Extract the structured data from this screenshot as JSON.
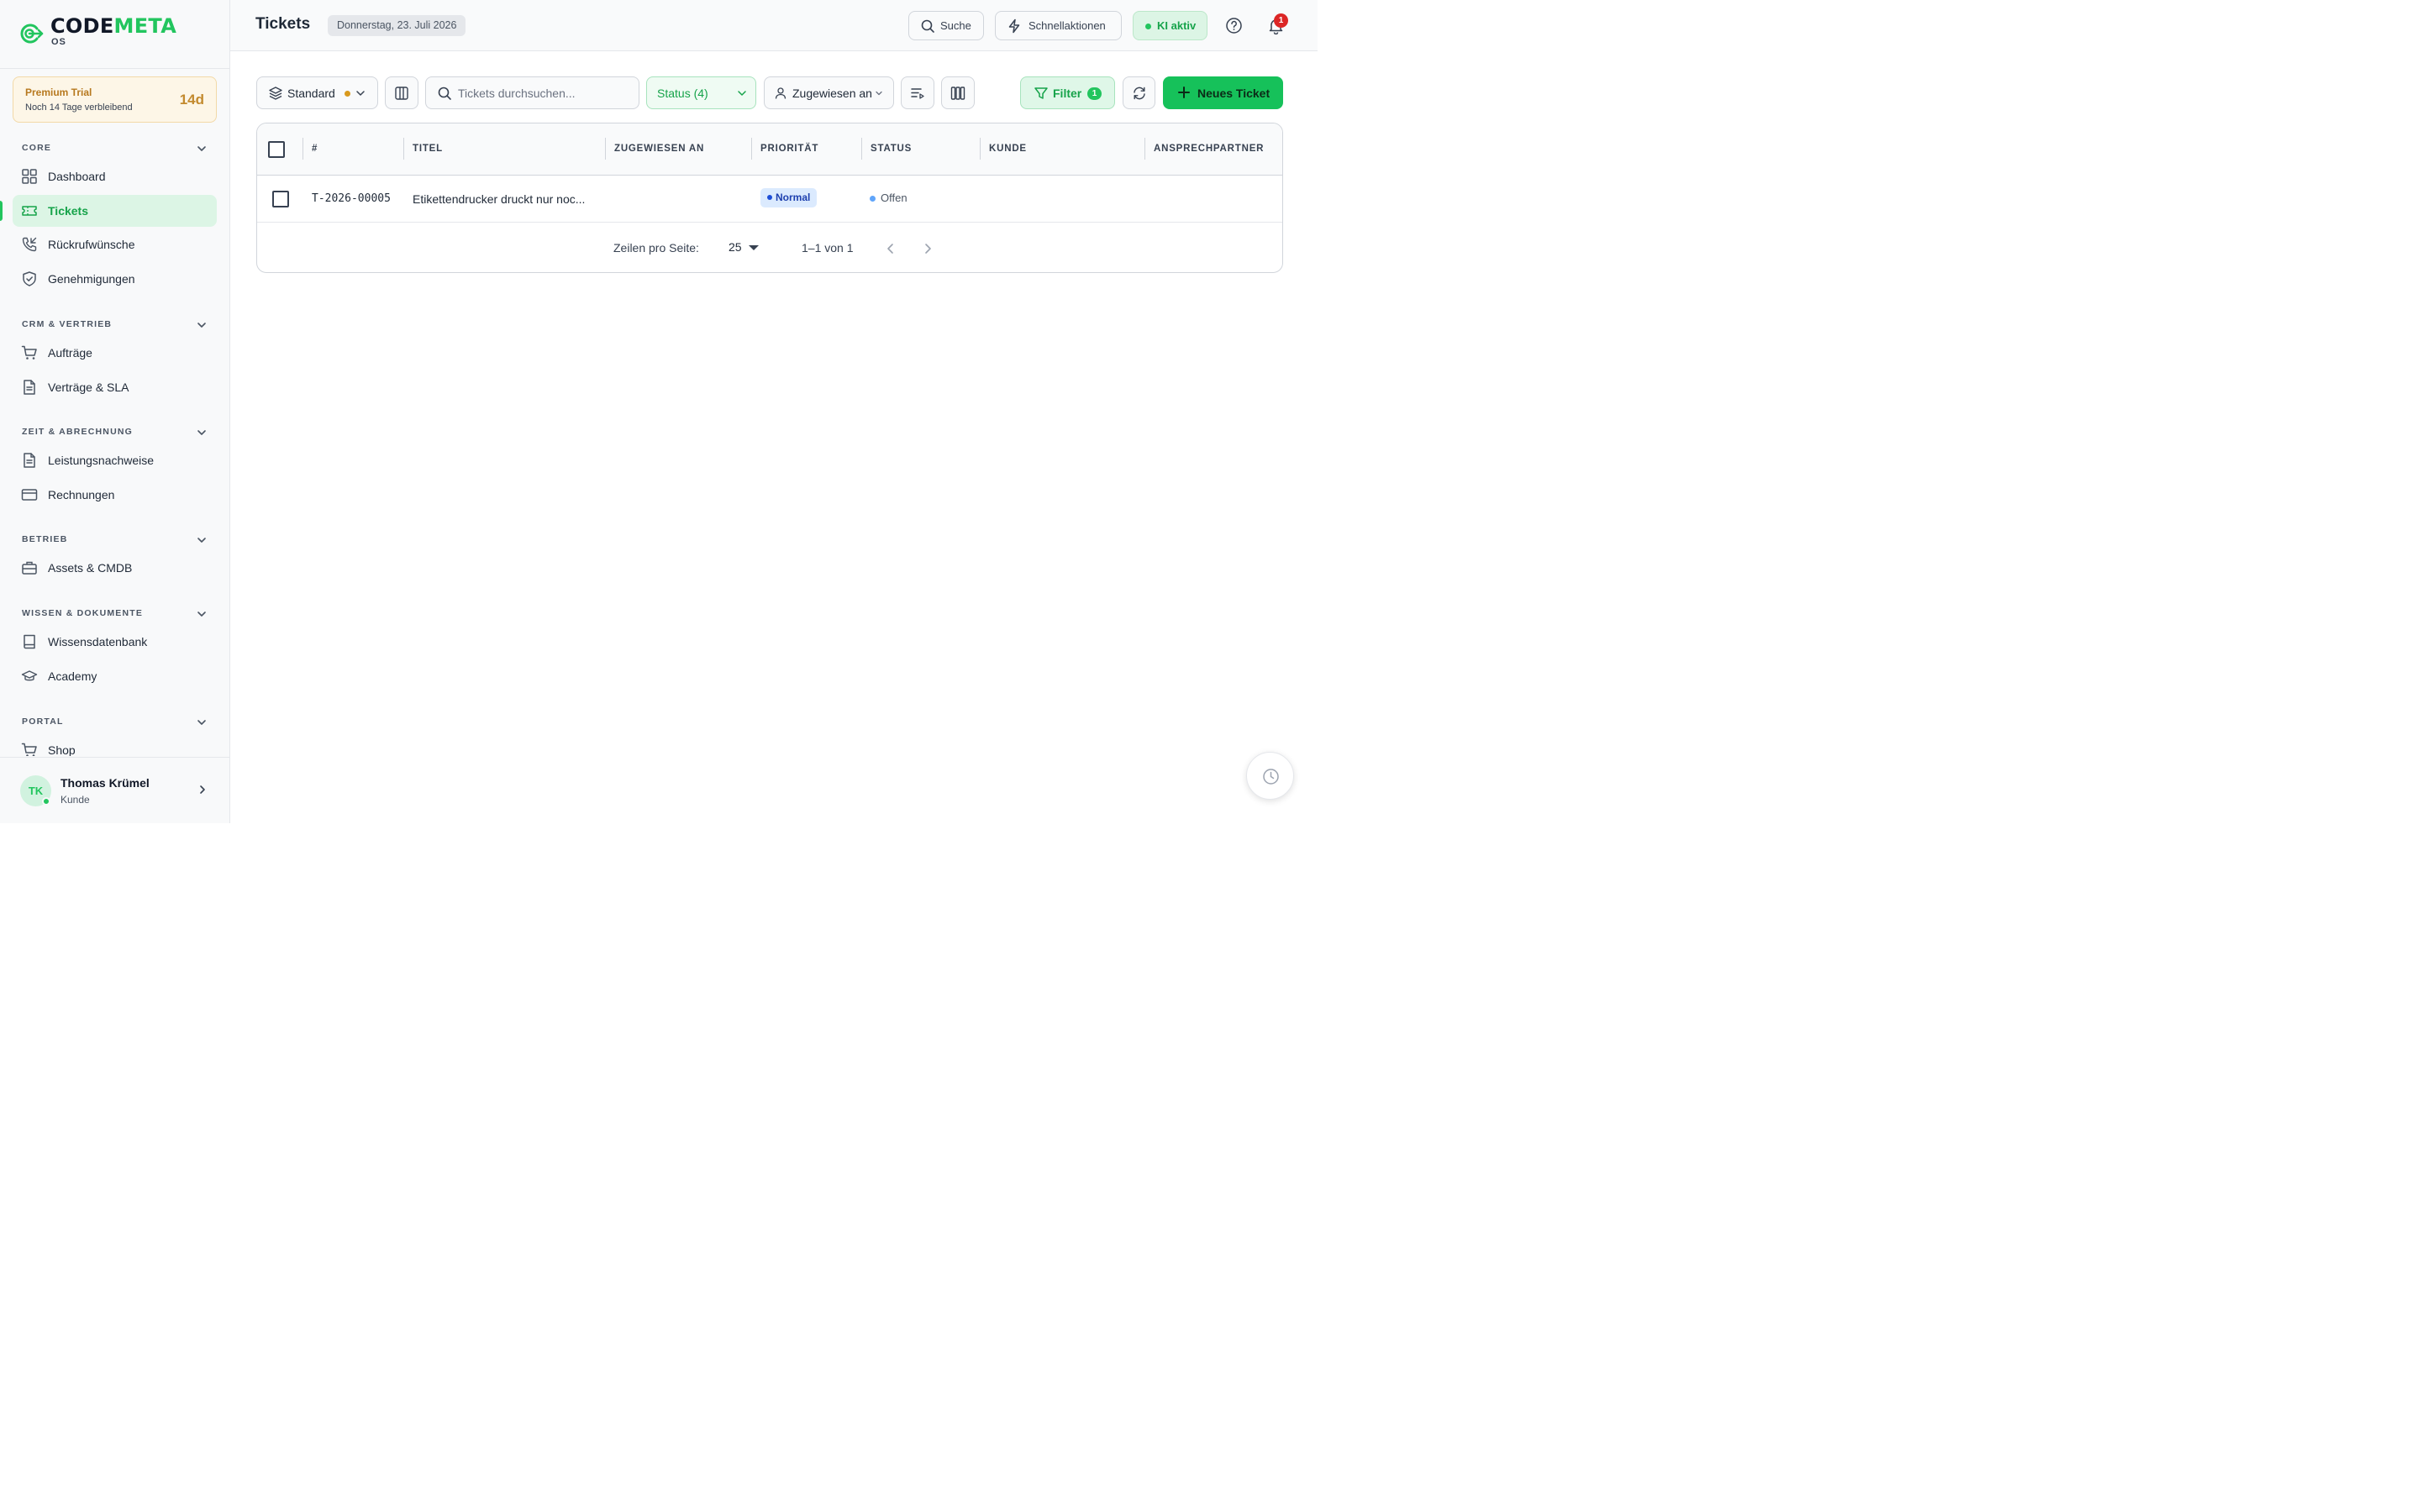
{
  "brand": {
    "name_part1": "CODE",
    "name_part2": "META",
    "sub": "OS"
  },
  "trial": {
    "title": "Premium Trial",
    "subtitle": "Noch 14 Tage verbleibend",
    "days": "14d"
  },
  "sidebar": {
    "sections": [
      {
        "label": "CORE",
        "items": [
          {
            "label": "Dashboard",
            "icon": "dashboard-grid-icon"
          },
          {
            "label": "Tickets",
            "icon": "ticket-icon",
            "active": true
          },
          {
            "label": "Rückrufwünsche",
            "icon": "phone-callback-icon"
          },
          {
            "label": "Genehmigungen",
            "icon": "shield-check-icon"
          }
        ]
      },
      {
        "label": "CRM & VERTRIEB",
        "items": [
          {
            "label": "Aufträge",
            "icon": "shopping-cart-icon"
          },
          {
            "label": "Verträge & SLA",
            "icon": "document-icon"
          }
        ]
      },
      {
        "label": "ZEIT & ABRECHNUNG",
        "items": [
          {
            "label": "Leistungsnachweise",
            "icon": "document-icon"
          },
          {
            "label": "Rechnungen",
            "icon": "credit-card-icon"
          }
        ]
      },
      {
        "label": "BETRIEB",
        "items": [
          {
            "label": "Assets & CMDB",
            "icon": "briefcase-icon"
          }
        ]
      },
      {
        "label": "WISSEN & DOKUMENTE",
        "items": [
          {
            "label": "Wissensdatenbank",
            "icon": "book-icon"
          },
          {
            "label": "Academy",
            "icon": "graduation-cap-icon"
          }
        ]
      },
      {
        "label": "PORTAL",
        "items": [
          {
            "label": "Shop",
            "icon": "shopping-cart-icon"
          }
        ]
      }
    ]
  },
  "user": {
    "initials": "TK",
    "name": "Thomas Krümel",
    "role": "Kunde"
  },
  "header": {
    "title": "Tickets",
    "date": "Donnerstag, 23. Juli 2026",
    "search_label": "Suche",
    "quick_actions_label": "Schnellaktionen",
    "ai_label": "KI aktiv",
    "notification_count": "1"
  },
  "toolbar": {
    "view_label": "Standard",
    "search_placeholder": "Tickets durchsuchen...",
    "status_label": "Status (4)",
    "assignee_label": "Zugewiesen an",
    "filter_label": "Filter",
    "filter_count": "1",
    "new_ticket_label": "Neues Ticket"
  },
  "table": {
    "columns": [
      "#",
      "TITEL",
      "ZUGEWIESEN AN",
      "PRIORITÄT",
      "STATUS",
      "KUNDE",
      "ANSPRECHPARTNER"
    ],
    "rows": [
      {
        "id": "T-2026-00005",
        "title": "Etikettendrucker druckt nur noc...",
        "assignee": "",
        "priority": "Normal",
        "status": "Offen",
        "customer": "",
        "contact": ""
      }
    ],
    "pagination": {
      "rows_per_page_label": "Zeilen pro Seite:",
      "rows_per_page": "25",
      "range": "1–1 von 1"
    }
  },
  "colors": {
    "accent": "#22c55e",
    "accent_dark": "#16a34a",
    "warning": "#b7791f",
    "priority_normal": "#1e40af",
    "status_open": "#60a5fa"
  }
}
